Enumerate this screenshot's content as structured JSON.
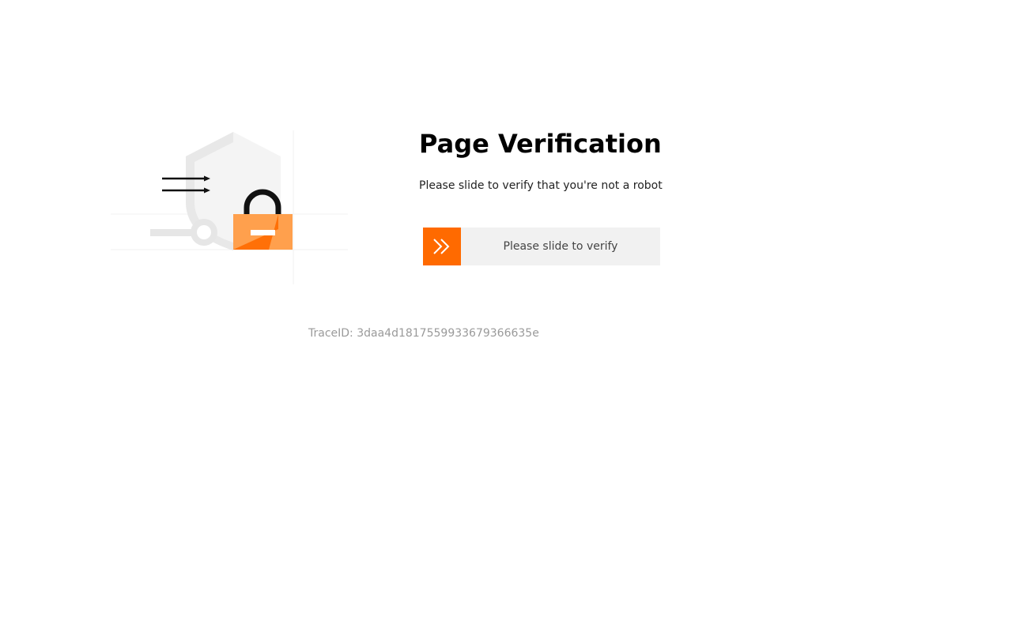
{
  "page": {
    "title": "Page Verification",
    "subtitle": "Please slide to verify that you're not a robot"
  },
  "slider": {
    "label": "Please slide to verify",
    "handle_icon": "double-chevron-right-icon",
    "progress": 0
  },
  "trace": {
    "text": "TraceID: 3daa4d1817559933679366635e"
  },
  "illustration": {
    "icons": [
      "shield-icon",
      "padlock-icon",
      "key-icon",
      "arrows-icon"
    ]
  },
  "colors": {
    "accent": "#ff6a00",
    "accent_light": "#ffa04d",
    "track": "#f1f1f1",
    "muted_text": "#9a9a9a"
  }
}
